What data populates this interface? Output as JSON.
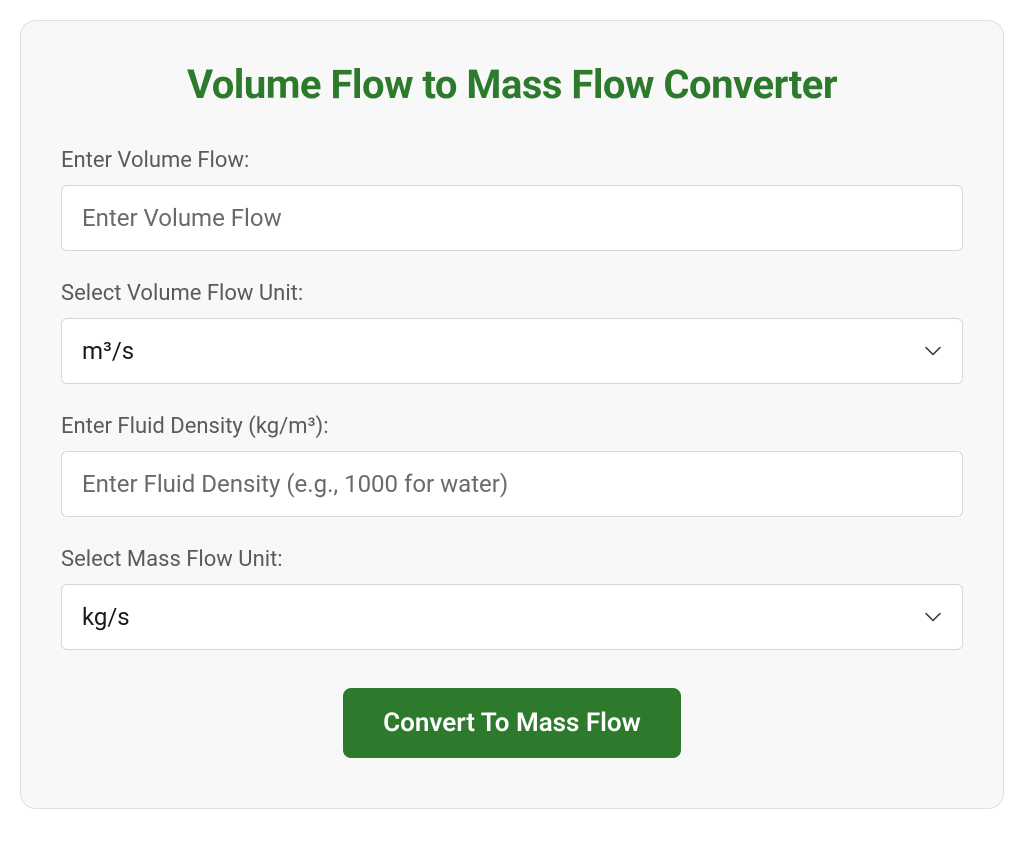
{
  "title": "Volume Flow to Mass Flow Converter",
  "fields": {
    "volume_flow": {
      "label": "Enter Volume Flow:",
      "placeholder": "Enter Volume Flow",
      "value": ""
    },
    "volume_flow_unit": {
      "label": "Select Volume Flow Unit:",
      "selected": "m³/s"
    },
    "fluid_density": {
      "label": "Enter Fluid Density (kg/m³):",
      "placeholder": "Enter Fluid Density (e.g., 1000 for water)",
      "value": ""
    },
    "mass_flow_unit": {
      "label": "Select Mass Flow Unit:",
      "selected": "kg/s"
    }
  },
  "button": {
    "convert_label": "Convert To Mass Flow"
  },
  "colors": {
    "accent": "#2d7a2d"
  }
}
